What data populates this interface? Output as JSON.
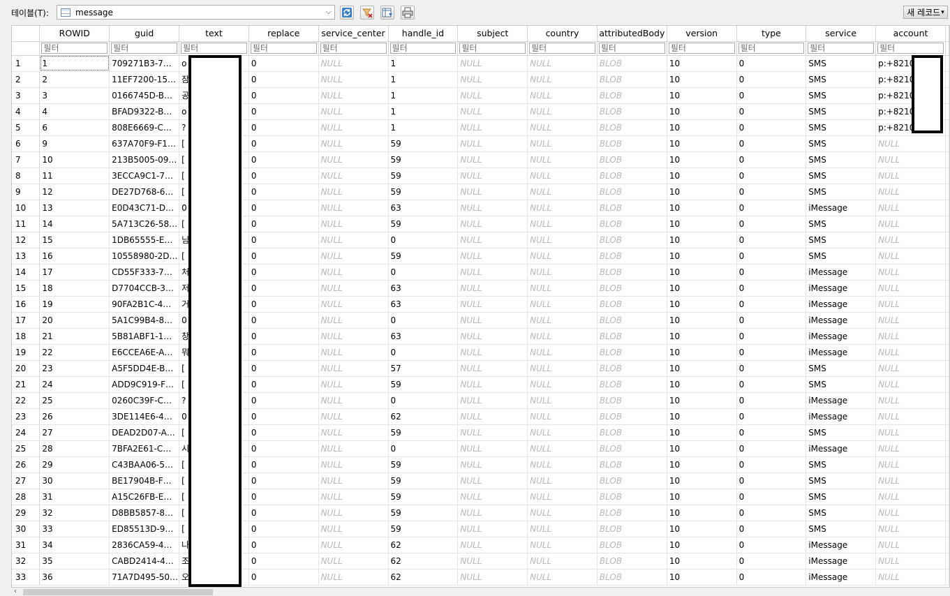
{
  "toolbar": {
    "table_label": "테이블(T):",
    "table_value": "message",
    "new_record_label": "새 레코드"
  },
  "columns": [
    "ROWID",
    "guid",
    "text",
    "replace",
    "service_center",
    "handle_id",
    "subject",
    "country",
    "attributedBody",
    "version",
    "type",
    "service",
    "account"
  ],
  "filter_placeholder": "필터",
  "rows": [
    {
      "n": "1",
      "rowid": "1",
      "guid": "709271B3-7…",
      "text": "o",
      "replace": "0",
      "handle_id": "1",
      "version": "10",
      "type": "0",
      "service": "SMS",
      "account": "p:+8210"
    },
    {
      "n": "2",
      "rowid": "2",
      "guid": "11EF7200-15…",
      "text": "잠",
      "replace": "0",
      "handle_id": "1",
      "version": "10",
      "type": "0",
      "service": "SMS",
      "account": "p:+8210"
    },
    {
      "n": "3",
      "rowid": "3",
      "guid": "0166745D-B…",
      "text": "공",
      "replace": "0",
      "handle_id": "1",
      "version": "10",
      "type": "0",
      "service": "SMS",
      "account": "p:+8210"
    },
    {
      "n": "4",
      "rowid": "4",
      "guid": "BFAD9322-B…",
      "text": "o",
      "replace": "0",
      "handle_id": "1",
      "version": "10",
      "type": "0",
      "service": "SMS",
      "account": "p:+8210"
    },
    {
      "n": "5",
      "rowid": "6",
      "guid": "808E6669-C…",
      "text": "?",
      "replace": "0",
      "handle_id": "1",
      "version": "10",
      "type": "0",
      "service": "SMS",
      "account": "p:+8210"
    },
    {
      "n": "6",
      "rowid": "9",
      "guid": "637A70F9-F1…",
      "text": "[",
      "replace": "0",
      "handle_id": "59",
      "version": "10",
      "type": "0",
      "service": "SMS",
      "account": null
    },
    {
      "n": "7",
      "rowid": "10",
      "guid": "213B5005-09…",
      "text": "[",
      "replace": "0",
      "handle_id": "59",
      "version": "10",
      "type": "0",
      "service": "SMS",
      "account": null
    },
    {
      "n": "8",
      "rowid": "11",
      "guid": "3ECCA9C1-7…",
      "text": "[",
      "replace": "0",
      "handle_id": "59",
      "version": "10",
      "type": "0",
      "service": "SMS",
      "account": null
    },
    {
      "n": "9",
      "rowid": "12",
      "guid": "DE27D768-6…",
      "text": "[",
      "replace": "0",
      "handle_id": "59",
      "version": "10",
      "type": "0",
      "service": "SMS",
      "account": null
    },
    {
      "n": "10",
      "rowid": "13",
      "guid": "E0D43C71-D…",
      "text": "0",
      "replace": "0",
      "handle_id": "63",
      "version": "10",
      "type": "0",
      "service": "iMessage",
      "account": null
    },
    {
      "n": "11",
      "rowid": "14",
      "guid": "5A713C26-58…",
      "text": "[",
      "replace": "0",
      "handle_id": "59",
      "version": "10",
      "type": "0",
      "service": "SMS",
      "account": null
    },
    {
      "n": "12",
      "rowid": "15",
      "guid": "1DB65555-E…",
      "text": "님",
      "replace": "0",
      "handle_id": "0",
      "version": "10",
      "type": "0",
      "service": "SMS",
      "account": null
    },
    {
      "n": "13",
      "rowid": "16",
      "guid": "10558980-2D…",
      "text": "[",
      "replace": "0",
      "handle_id": "59",
      "version": "10",
      "type": "0",
      "service": "SMS",
      "account": null
    },
    {
      "n": "14",
      "rowid": "17",
      "guid": "CD55F333-7…",
      "text": "처",
      "replace": "0",
      "handle_id": "0",
      "version": "10",
      "type": "0",
      "service": "iMessage",
      "account": null
    },
    {
      "n": "15",
      "rowid": "18",
      "guid": "D7704CCB-3…",
      "text": "저",
      "replace": "0",
      "handle_id": "63",
      "version": "10",
      "type": "0",
      "service": "iMessage",
      "account": null
    },
    {
      "n": "16",
      "rowid": "19",
      "guid": "90FA2B1C-4…",
      "text": "거",
      "replace": "0",
      "handle_id": "63",
      "version": "10",
      "type": "0",
      "service": "iMessage",
      "account": null
    },
    {
      "n": "17",
      "rowid": "20",
      "guid": "5A1C99B4-8…",
      "text": "0",
      "replace": "0",
      "handle_id": "0",
      "version": "10",
      "type": "0",
      "service": "iMessage",
      "account": null
    },
    {
      "n": "18",
      "rowid": "21",
      "guid": "5B81ABF1-1…",
      "text": "창",
      "replace": "0",
      "handle_id": "63",
      "version": "10",
      "type": "0",
      "service": "iMessage",
      "account": null
    },
    {
      "n": "19",
      "rowid": "22",
      "guid": "E6CCEA6E-A…",
      "text": "뭐",
      "replace": "0",
      "handle_id": "0",
      "version": "10",
      "type": "0",
      "service": "iMessage",
      "account": null
    },
    {
      "n": "20",
      "rowid": "23",
      "guid": "A5F5DD4E-B…",
      "text": "[",
      "replace": "0",
      "handle_id": "57",
      "version": "10",
      "type": "0",
      "service": "SMS",
      "account": null
    },
    {
      "n": "21",
      "rowid": "24",
      "guid": "ADD9C919-F…",
      "text": "[",
      "replace": "0",
      "handle_id": "59",
      "version": "10",
      "type": "0",
      "service": "SMS",
      "account": null
    },
    {
      "n": "22",
      "rowid": "25",
      "guid": "0260C39F-C…",
      "text": "?",
      "replace": "0",
      "handle_id": "0",
      "version": "10",
      "type": "0",
      "service": "iMessage",
      "account": null
    },
    {
      "n": "23",
      "rowid": "26",
      "guid": "3DE114E6-4…",
      "text": "0",
      "replace": "0",
      "handle_id": "62",
      "version": "10",
      "type": "0",
      "service": "iMessage",
      "account": null
    },
    {
      "n": "24",
      "rowid": "27",
      "guid": "DEAD2D07-A…",
      "text": "[",
      "replace": "0",
      "handle_id": "59",
      "version": "10",
      "type": "0",
      "service": "SMS",
      "account": null
    },
    {
      "n": "25",
      "rowid": "28",
      "guid": "7BFA2E61-C…",
      "text": "시",
      "replace": "0",
      "handle_id": "0",
      "version": "10",
      "type": "0",
      "service": "iMessage",
      "account": null
    },
    {
      "n": "26",
      "rowid": "29",
      "guid": "C43BAA06-5…",
      "text": "[",
      "replace": "0",
      "handle_id": "59",
      "version": "10",
      "type": "0",
      "service": "SMS",
      "account": null
    },
    {
      "n": "27",
      "rowid": "30",
      "guid": "BE17904B-F…",
      "text": "[",
      "replace": "0",
      "handle_id": "59",
      "version": "10",
      "type": "0",
      "service": "SMS",
      "account": null
    },
    {
      "n": "28",
      "rowid": "31",
      "guid": "A15C26FB-E…",
      "text": "[",
      "replace": "0",
      "handle_id": "59",
      "version": "10",
      "type": "0",
      "service": "SMS",
      "account": null
    },
    {
      "n": "29",
      "rowid": "32",
      "guid": "D8BB5857-8…",
      "text": "[",
      "replace": "0",
      "handle_id": "59",
      "version": "10",
      "type": "0",
      "service": "SMS",
      "account": null
    },
    {
      "n": "30",
      "rowid": "33",
      "guid": "ED85513D-9…",
      "text": "[",
      "replace": "0",
      "handle_id": "59",
      "version": "10",
      "type": "0",
      "service": "SMS",
      "account": null
    },
    {
      "n": "31",
      "rowid": "34",
      "guid": "2836CA59-4…",
      "text": "나",
      "replace": "0",
      "handle_id": "62",
      "version": "10",
      "type": "0",
      "service": "iMessage",
      "account": null
    },
    {
      "n": "32",
      "rowid": "35",
      "guid": "CABD2414-4…",
      "text": "조",
      "replace": "0",
      "handle_id": "62",
      "version": "10",
      "type": "0",
      "service": "iMessage",
      "account": null
    },
    {
      "n": "33",
      "rowid": "36",
      "guid": "71A7D495-50…",
      "text": "오",
      "replace": "0",
      "handle_id": "62",
      "version": "10",
      "type": "0",
      "service": "iMessage",
      "account": null
    }
  ],
  "null_text": "NULL",
  "blob_text": "BLOB",
  "icons": {
    "refresh": "refresh-icon",
    "clear_filters": "clear-filters-icon",
    "save_table": "save-table-icon",
    "print": "print-icon"
  }
}
